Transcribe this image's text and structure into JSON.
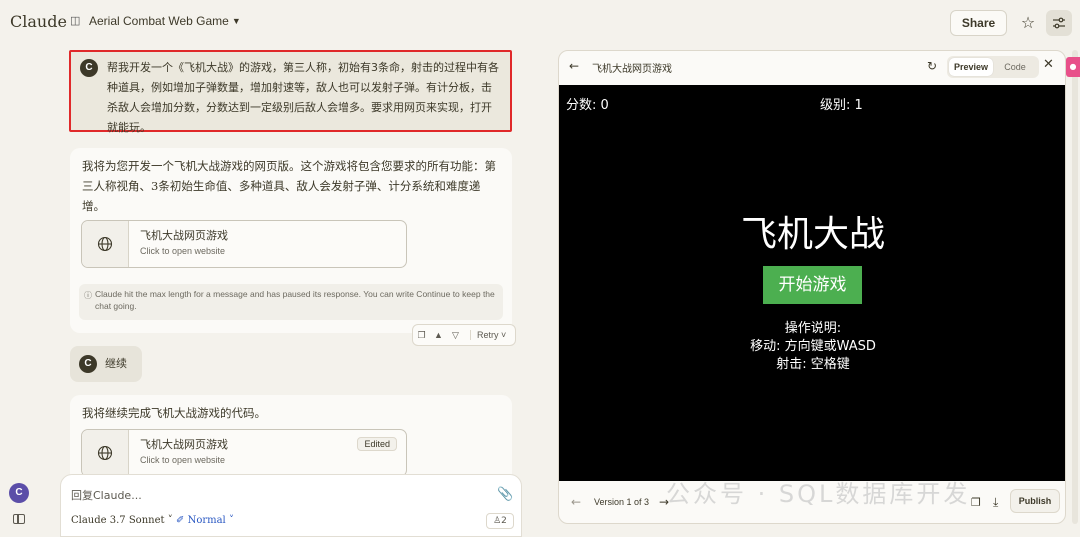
{
  "header": {
    "logo": "Claude",
    "chat_title": "Aerial Combat Web Game",
    "share_label": "Share"
  },
  "messages": {
    "user1": {
      "avatar": "C",
      "text": "帮我开发一个《飞机大战》的游戏，第三人称，初始有3条命，射击的过程中有各种道具，例如增加子弹数量，增加射速等，敌人也可以发射子弹。有计分板，击杀敌人会增加分数，分数达到一定级别后敌人会增多。要求用网页来实现，打开就能玩。"
    },
    "ai1": {
      "text": "我将为您开发一个飞机大战游戏的网页版。这个游戏将包含您要求的所有功能：第三人称视角、3条初始生命值、多种道具、敌人会发射子弹、计分系统和难度递增。",
      "artifact_title": "飞机大战网页游戏",
      "artifact_sub": "Click to open website",
      "notice": "Claude hit the max length for a message and has paused its response. You can write Continue to keep the chat going.",
      "retry_label": "Retry"
    },
    "user2": {
      "avatar": "C",
      "text": "继续"
    },
    "ai2": {
      "text": "我将继续完成飞机大战游戏的代码。",
      "artifact_title": "飞机大战网页游戏",
      "artifact_sub": "Click to open website",
      "badge": "Edited"
    }
  },
  "composer": {
    "placeholder": "回复Claude...",
    "model": "Claude 3.7 Sonnet",
    "style": "Normal",
    "count": "2"
  },
  "sidebar": {
    "avatar": "C"
  },
  "panel": {
    "title": "飞机大战网页游戏",
    "tab_preview": "Preview",
    "tab_code": "Code",
    "game": {
      "score": "分数: 0",
      "level": "级别: 1",
      "title": "飞机大战",
      "start": "开始游戏",
      "instr_title": "操作说明:",
      "instr_move": "移动: 方向键或WASD",
      "instr_shoot": "射击: 空格键"
    },
    "version": "Version 1 of 3",
    "publish": "Publish"
  },
  "watermark": "公众号 · SQL数据库开发",
  "colors": {
    "highlight_border": "#e0292a",
    "start_button": "#4caf50",
    "style_link": "#2b59c3",
    "avatar_purple": "#5b4ea8"
  }
}
